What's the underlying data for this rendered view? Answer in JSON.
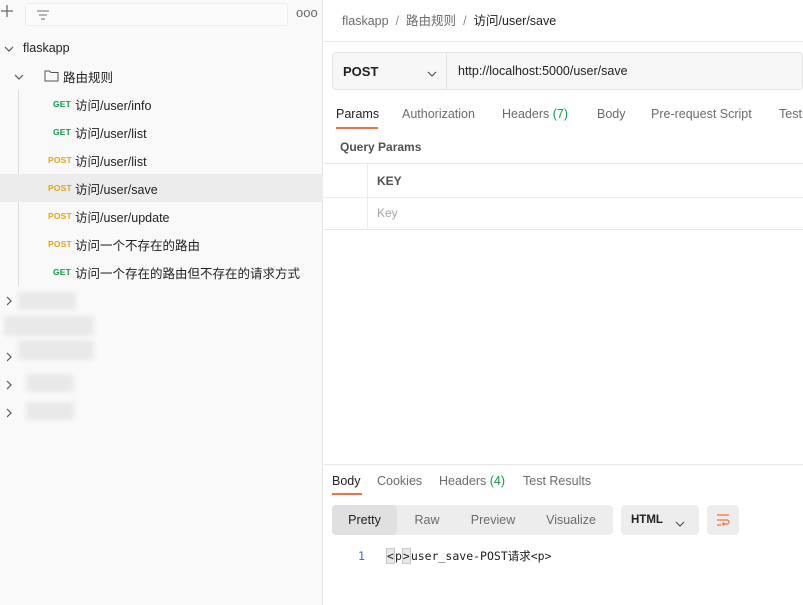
{
  "sidebar": {
    "toolbar": {
      "add_icon": "plus-icon",
      "filter_icon": "filter-icon",
      "more_label": "ooo"
    },
    "collection": {
      "name": "flaskapp"
    },
    "folder": {
      "name": "路由规则"
    },
    "requests": [
      {
        "method": "GET",
        "name": "访问/user/info"
      },
      {
        "method": "GET",
        "name": "访问/user/list"
      },
      {
        "method": "POST",
        "name": "访问/user/list"
      },
      {
        "method": "POST",
        "name": "访问/user/save"
      },
      {
        "method": "POST",
        "name": "访问/user/update"
      },
      {
        "method": "POST",
        "name": "访问一个不存在的路由"
      },
      {
        "method": "GET",
        "name": "访问一个存在的路由但不存在的请求方式"
      }
    ]
  },
  "breadcrumb": {
    "collection": "flaskapp",
    "folder": "路由规则",
    "request": "访问/user/save",
    "separator": "/"
  },
  "request": {
    "method": "POST",
    "url": "http://localhost:5000/user/save",
    "tabs": {
      "params": "Params",
      "authorization": "Authorization",
      "headers": "Headers",
      "headers_count": "(7)",
      "body": "Body",
      "prerequest": "Pre-request Script",
      "tests": "Test"
    },
    "query_params_title": "Query Params",
    "key_header": "KEY",
    "key_placeholder": "Key"
  },
  "response": {
    "tabs": {
      "body": "Body",
      "cookies": "Cookies",
      "headers": "Headers",
      "headers_count": "(4)",
      "test_results": "Test Results"
    },
    "view_modes": [
      "Pretty",
      "Raw",
      "Preview",
      "Visualize"
    ],
    "format": "HTML",
    "code": {
      "line_number": "1",
      "tag_open_lt": "<",
      "tag_open_name": "p",
      "tag_open_gt": ">",
      "content": "user_save-POST请求",
      "tag_close": "<p>"
    }
  },
  "colors": {
    "accent": "#ff6c37",
    "get": "#0e9b4b",
    "post": "#e7a210"
  }
}
